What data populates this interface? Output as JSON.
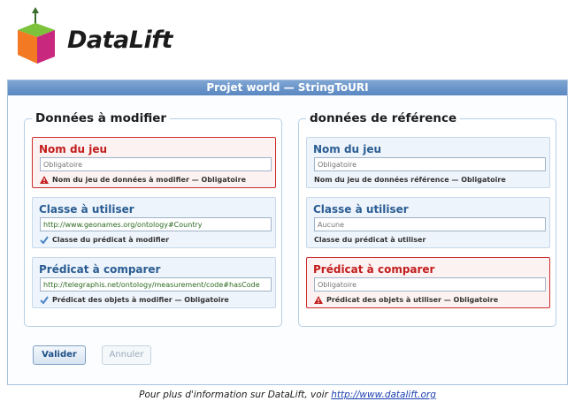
{
  "app": {
    "logo_text": "DataLift"
  },
  "panel": {
    "title": "Projet world — StringToURI"
  },
  "left": {
    "legend": "Données à modifier",
    "fields": [
      {
        "title": "Nom du jeu",
        "value": "",
        "placeholder": "Obligatoire",
        "help": "Nom du jeu de données à modifier — Obligatoire",
        "state": "error"
      },
      {
        "title": "Classe à utiliser",
        "value": "http://www.geonames.org/ontology#Country",
        "placeholder": "",
        "help": "Classe du prédicat à modifier",
        "state": "ok"
      },
      {
        "title": "Prédicat à comparer",
        "value": "http://telegraphis.net/ontology/measurement/code#hasCode",
        "placeholder": "",
        "help": "Prédicat des objets à modifier — Obligatoire",
        "state": "ok"
      }
    ]
  },
  "right": {
    "legend": "données de référence",
    "fields": [
      {
        "title": "Nom du jeu",
        "value": "",
        "placeholder": "Obligatoire",
        "help": "Nom du jeu de données référence — Obligatoire",
        "state": "normal"
      },
      {
        "title": "Classe à utiliser",
        "value": "",
        "placeholder": "Aucune",
        "help": "Classe du prédicat à utiliser",
        "state": "normal"
      },
      {
        "title": "Prédicat à comparer",
        "value": "",
        "placeholder": "Obligatoire",
        "help": "Prédicat des objets à utiliser — Obligatoire",
        "state": "error"
      }
    ]
  },
  "buttons": {
    "submit": "Valider",
    "cancel": "Annuler"
  },
  "footer": {
    "text": "Pour plus d'information sur DataLift, voir ",
    "link": "http://www.datalift.org"
  },
  "colors": {
    "accent": "#5a87c1",
    "error": "#cc2e2e",
    "ok": "#4a86c6"
  }
}
